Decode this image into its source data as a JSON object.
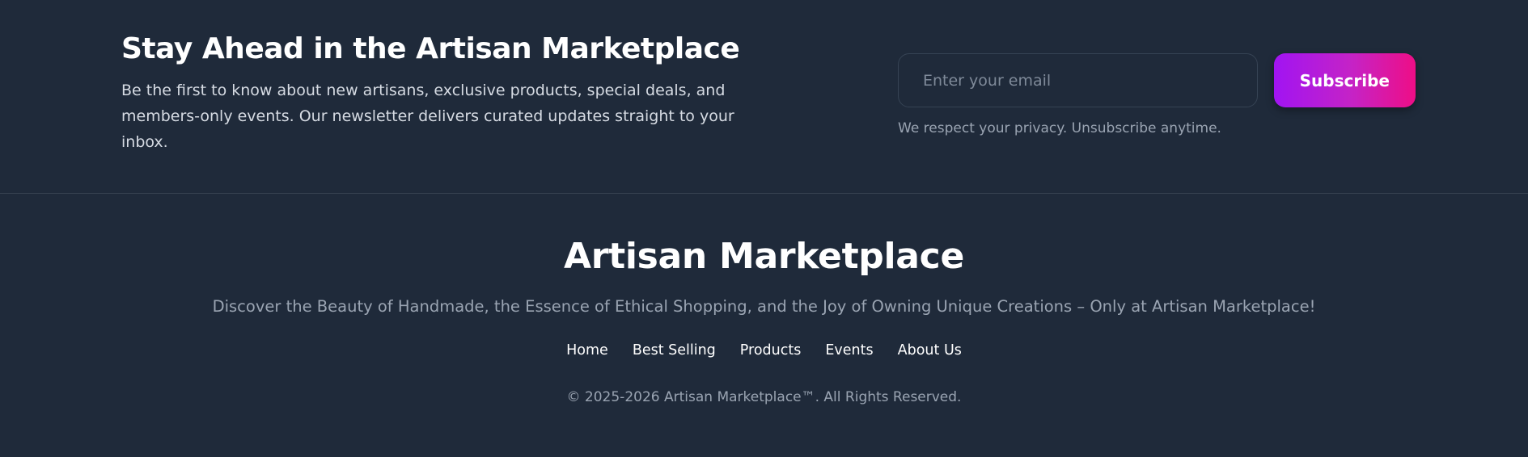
{
  "newsletter": {
    "title": "Stay Ahead in the Artisan Marketplace",
    "description": "Be the first to know about new artisans, exclusive products, special deals, and members-only events. Our newsletter delivers curated updates straight to your inbox.",
    "email_placeholder": "Enter your email",
    "subscribe_label": "Subscribe",
    "privacy_note": "We respect your privacy. Unsubscribe anytime."
  },
  "footer": {
    "brand": "Artisan Marketplace",
    "tagline": "Discover the Beauty of Handmade, the Essence of Ethical Shopping, and the Joy of Owning Unique Creations – Only at Artisan Marketplace!",
    "nav": [
      {
        "label": "Home"
      },
      {
        "label": "Best Selling"
      },
      {
        "label": "Products"
      },
      {
        "label": "Events"
      },
      {
        "label": "About Us"
      }
    ],
    "copyright": "© 2025-2026 Artisan Marketplace™. All Rights Reserved."
  },
  "colors": {
    "background": "#1f2a3a",
    "button_gradient_start": "#a114f2",
    "button_gradient_end": "#ee0e86",
    "muted_text": "#9aa4b2"
  }
}
